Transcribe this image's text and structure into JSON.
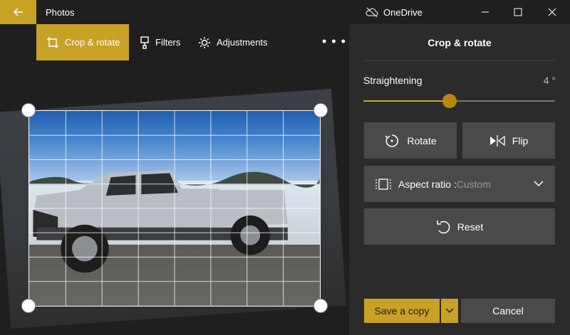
{
  "window": {
    "app_title": "Photos",
    "cloud_label": "OneDrive",
    "back_icon": "arrow-left-icon",
    "cloud_icon": "cloud-off-icon",
    "controls": [
      "minimize-icon",
      "maximize-icon",
      "close-icon"
    ]
  },
  "toolbar": {
    "crop_label": "Crop & rotate",
    "filters_label": "Filters",
    "adjustments_label": "Adjustments",
    "more_label": "• • •"
  },
  "panel": {
    "title": "Crop & rotate",
    "straightening": {
      "label": "Straightening",
      "value": "4 °",
      "level": 0.45
    },
    "rotate_label": "Rotate",
    "flip_label": "Flip",
    "aspect": {
      "label": "Aspect ratio : ",
      "value": "Custom"
    },
    "reset_label": "Reset",
    "save_label": "Save a copy",
    "cancel_label": "Cancel"
  },
  "colors": {
    "accent": "#c8a227",
    "panel_bg": "#2b2b2b",
    "button_bg": "#4a4a4a"
  }
}
